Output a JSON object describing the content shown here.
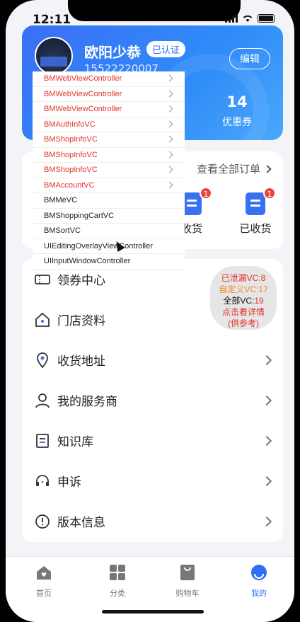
{
  "status": {
    "time": "12:11"
  },
  "profile": {
    "name": "欧阳少恭",
    "verified": "已认证",
    "phone": "15522220007",
    "edit": "编辑",
    "coupon_count": "14",
    "coupon_label": "优惠券"
  },
  "orders": {
    "view_all": "查看全部订单",
    "items": [
      {
        "label": "收货",
        "badge": "1"
      },
      {
        "label": "已收货",
        "badge": "1"
      }
    ]
  },
  "menu": {
    "items": [
      {
        "label": "领券中心",
        "icon": "ticket-icon"
      },
      {
        "label": "门店资料",
        "icon": "store-icon"
      },
      {
        "label": "收货地址",
        "icon": "location-icon"
      },
      {
        "label": "我的服务商",
        "icon": "person-icon"
      },
      {
        "label": "知识库",
        "icon": "book-icon"
      },
      {
        "label": "申诉",
        "icon": "headset-icon"
      },
      {
        "label": "版本信息",
        "icon": "info-icon"
      }
    ]
  },
  "debug": {
    "controllers": [
      {
        "name": "BMWebViewController",
        "leaked": true
      },
      {
        "name": "BMWebViewController",
        "leaked": true
      },
      {
        "name": "BMWebViewController",
        "leaked": true
      },
      {
        "name": "BMAuthInfoVC",
        "leaked": true
      },
      {
        "name": "BMShopInfoVC",
        "leaked": true
      },
      {
        "name": "BMShopInfoVC",
        "leaked": true
      },
      {
        "name": "BMShopInfoVC",
        "leaked": true
      },
      {
        "name": "BMAccountVC",
        "leaked": true
      },
      {
        "name": "BMMeVC",
        "leaked": false
      },
      {
        "name": "BMShoppingCartVC",
        "leaked": false
      },
      {
        "name": "BMSortVC",
        "leaked": false
      },
      {
        "name": "UIEditingOverlayViewController",
        "leaked": false
      },
      {
        "name": "UIInputWindowController",
        "leaked": false
      }
    ],
    "leaked_line": "已泄漏VC:8",
    "custom_line": "自定义VC:17",
    "total_prefix": "全部VC:",
    "total_value": "19",
    "detail_line": "点击看详情",
    "ref_line": "(供参考)"
  },
  "tabbar": {
    "tabs": [
      {
        "label": "首页"
      },
      {
        "label": "分类"
      },
      {
        "label": "购物车"
      },
      {
        "label": "我的"
      }
    ],
    "active_color": "#2f6ff5"
  }
}
